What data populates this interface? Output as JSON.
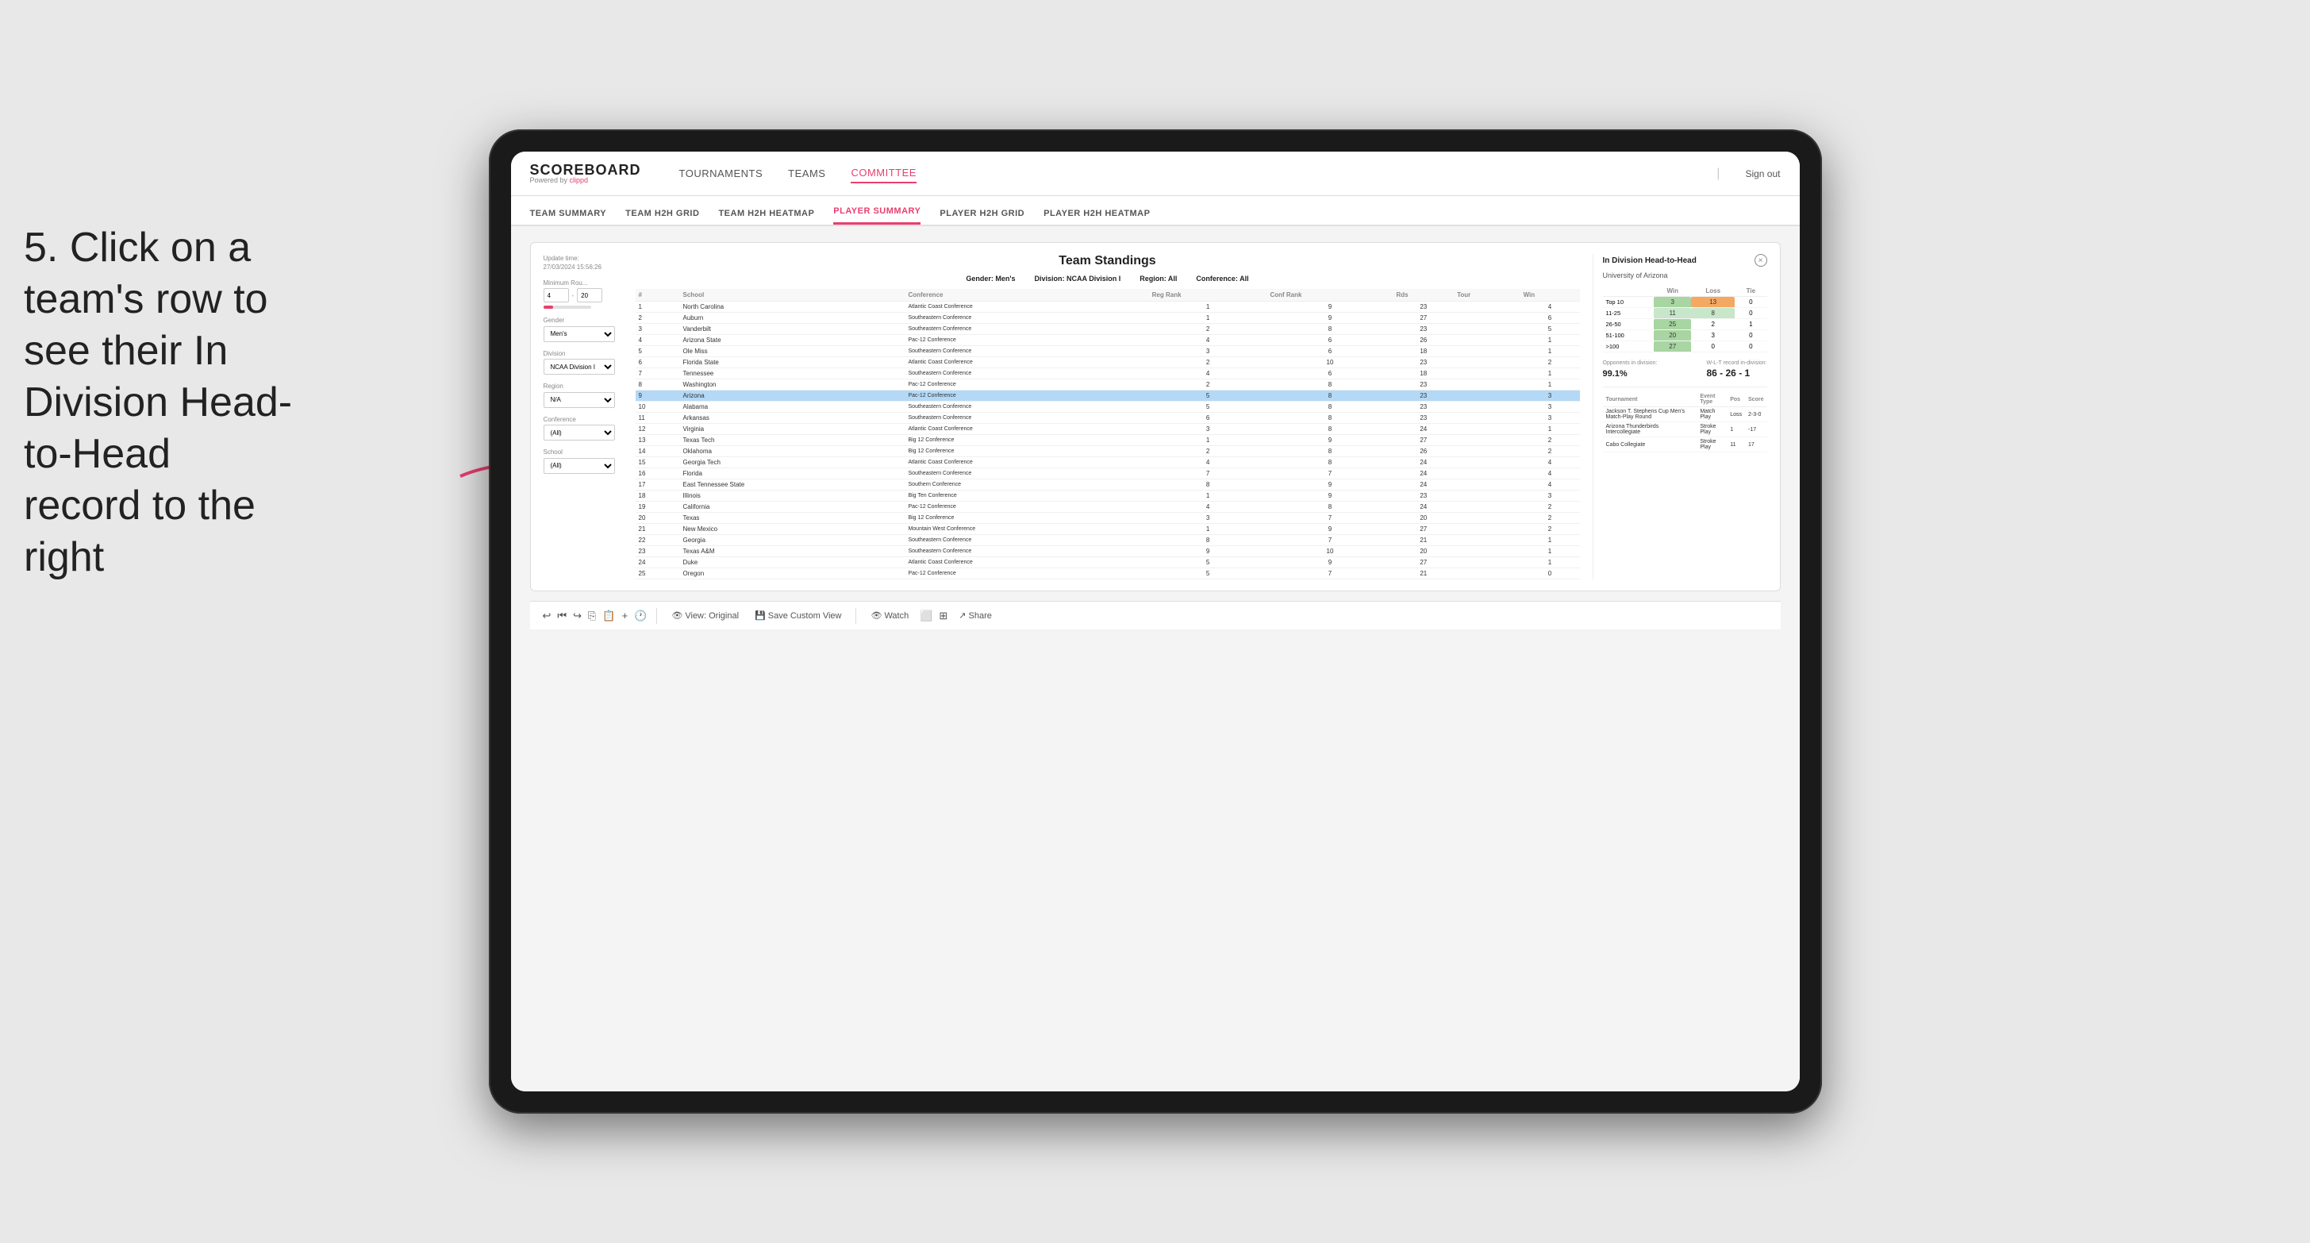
{
  "instruction": {
    "text": "5. Click on a team's row to see their In Division Head-to-Head record to the right"
  },
  "nav": {
    "logo_main": "SCOREBOARD",
    "logo_sub": "Powered by",
    "logo_brand": "clippd",
    "items": [
      "TOURNAMENTS",
      "TEAMS",
      "COMMITTEE"
    ],
    "active_item": "COMMITTEE",
    "sign_out": "Sign out"
  },
  "sub_nav": {
    "items": [
      "TEAM SUMMARY",
      "TEAM H2H GRID",
      "TEAM H2H HEATMAP",
      "PLAYER SUMMARY",
      "PLAYER H2H GRID",
      "PLAYER H2H HEATMAP"
    ],
    "active_item": "PLAYER SUMMARY"
  },
  "update_time_label": "Update time:",
  "update_time": "27/03/2024 15:56:26",
  "standings": {
    "title": "Team Standings",
    "meta": {
      "gender_label": "Gender:",
      "gender": "Men's",
      "division_label": "Division:",
      "division": "NCAA Division I",
      "region_label": "Region:",
      "region": "All",
      "conference_label": "Conference:",
      "conference": "All"
    },
    "filters": {
      "minimum_rou_label": "Minimum Rou...",
      "min_value": "4",
      "max_value": "20",
      "gender_label": "Gender",
      "gender_value": "Men's",
      "division_label": "Division",
      "division_value": "NCAA Division I",
      "region_label": "Region",
      "region_value": "N/A",
      "conference_label": "Conference",
      "conference_value": "(All)",
      "school_label": "School",
      "school_value": "(All)"
    },
    "columns": [
      "#",
      "School",
      "Conference",
      "Reg Rank",
      "Conf Rank",
      "Rds",
      "Tour",
      "Win"
    ],
    "rows": [
      {
        "rank": 1,
        "school": "North Carolina",
        "conference": "Atlantic Coast Conference",
        "reg_rank": 1,
        "conf_rank": 9,
        "rds": 23,
        "tour": "",
        "win": 4
      },
      {
        "rank": 2,
        "school": "Auburn",
        "conference": "Southeastern Conference",
        "reg_rank": 1,
        "conf_rank": 9,
        "rds": 27,
        "tour": "",
        "win": 6
      },
      {
        "rank": 3,
        "school": "Vanderbilt",
        "conference": "Southeastern Conference",
        "reg_rank": 2,
        "conf_rank": 8,
        "rds": 23,
        "tour": "",
        "win": 5
      },
      {
        "rank": 4,
        "school": "Arizona State",
        "conference": "Pac-12 Conference",
        "reg_rank": 4,
        "conf_rank": 6,
        "rds": 26,
        "tour": "",
        "win": 1
      },
      {
        "rank": 5,
        "school": "Ole Miss",
        "conference": "Southeastern Conference",
        "reg_rank": 3,
        "conf_rank": 6,
        "rds": 18,
        "tour": "",
        "win": 1
      },
      {
        "rank": 6,
        "school": "Florida State",
        "conference": "Atlantic Coast Conference",
        "reg_rank": 2,
        "conf_rank": 10,
        "rds": 23,
        "tour": "",
        "win": 2
      },
      {
        "rank": 7,
        "school": "Tennessee",
        "conference": "Southeastern Conference",
        "reg_rank": 4,
        "conf_rank": 6,
        "rds": 18,
        "tour": "",
        "win": 1
      },
      {
        "rank": 8,
        "school": "Washington",
        "conference": "Pac-12 Conference",
        "reg_rank": 2,
        "conf_rank": 8,
        "rds": 23,
        "tour": "",
        "win": 1
      },
      {
        "rank": 9,
        "school": "Arizona",
        "conference": "Pac-12 Conference",
        "reg_rank": 5,
        "conf_rank": 8,
        "rds": 23,
        "tour": "",
        "win": 3,
        "selected": true
      },
      {
        "rank": 10,
        "school": "Alabama",
        "conference": "Southeastern Conference",
        "reg_rank": 5,
        "conf_rank": 8,
        "rds": 23,
        "tour": "",
        "win": 3
      },
      {
        "rank": 11,
        "school": "Arkansas",
        "conference": "Southeastern Conference",
        "reg_rank": 6,
        "conf_rank": 8,
        "rds": 23,
        "tour": "",
        "win": 3
      },
      {
        "rank": 12,
        "school": "Virginia",
        "conference": "Atlantic Coast Conference",
        "reg_rank": 3,
        "conf_rank": 8,
        "rds": 24,
        "tour": "",
        "win": 1
      },
      {
        "rank": 13,
        "school": "Texas Tech",
        "conference": "Big 12 Conference",
        "reg_rank": 1,
        "conf_rank": 9,
        "rds": 27,
        "tour": "",
        "win": 2
      },
      {
        "rank": 14,
        "school": "Oklahoma",
        "conference": "Big 12 Conference",
        "reg_rank": 2,
        "conf_rank": 8,
        "rds": 26,
        "tour": "",
        "win": 2
      },
      {
        "rank": 15,
        "school": "Georgia Tech",
        "conference": "Atlantic Coast Conference",
        "reg_rank": 4,
        "conf_rank": 8,
        "rds": 24,
        "tour": "",
        "win": 4
      },
      {
        "rank": 16,
        "school": "Florida",
        "conference": "Southeastern Conference",
        "reg_rank": 7,
        "conf_rank": 7,
        "rds": 24,
        "tour": "",
        "win": 4
      },
      {
        "rank": 17,
        "school": "East Tennessee State",
        "conference": "Southern Conference",
        "reg_rank": 8,
        "conf_rank": 9,
        "rds": 24,
        "tour": "",
        "win": 4
      },
      {
        "rank": 18,
        "school": "Illinois",
        "conference": "Big Ten Conference",
        "reg_rank": 1,
        "conf_rank": 9,
        "rds": 23,
        "tour": "",
        "win": 3
      },
      {
        "rank": 19,
        "school": "California",
        "conference": "Pac-12 Conference",
        "reg_rank": 4,
        "conf_rank": 8,
        "rds": 24,
        "tour": "",
        "win": 2
      },
      {
        "rank": 20,
        "school": "Texas",
        "conference": "Big 12 Conference",
        "reg_rank": 3,
        "conf_rank": 7,
        "rds": 20,
        "tour": "",
        "win": 2
      },
      {
        "rank": 21,
        "school": "New Mexico",
        "conference": "Mountain West Conference",
        "reg_rank": 1,
        "conf_rank": 9,
        "rds": 27,
        "tour": "",
        "win": 2
      },
      {
        "rank": 22,
        "school": "Georgia",
        "conference": "Southeastern Conference",
        "reg_rank": 8,
        "conf_rank": 7,
        "rds": 21,
        "tour": "",
        "win": 1
      },
      {
        "rank": 23,
        "school": "Texas A&M",
        "conference": "Southeastern Conference",
        "reg_rank": 9,
        "conf_rank": 10,
        "rds": 20,
        "tour": "",
        "win": 1
      },
      {
        "rank": 24,
        "school": "Duke",
        "conference": "Atlantic Coast Conference",
        "reg_rank": 5,
        "conf_rank": 9,
        "rds": 27,
        "tour": "",
        "win": 1
      },
      {
        "rank": 25,
        "school": "Oregon",
        "conference": "Pac-12 Conference",
        "reg_rank": 5,
        "conf_rank": 7,
        "rds": 21,
        "tour": "",
        "win": 0
      }
    ]
  },
  "h2h": {
    "title": "In Division Head-to-Head",
    "team": "University of Arizona",
    "close_btn": "×",
    "columns": [
      "",
      "Win",
      "Loss",
      "Tie"
    ],
    "rows": [
      {
        "label": "Top 10",
        "win": 3,
        "loss": 13,
        "tie": 0,
        "win_color": "green",
        "loss_color": "orange"
      },
      {
        "label": "11-25",
        "win": 11,
        "loss": 8,
        "tie": 0,
        "win_color": "lt-green",
        "loss_color": "lt-green"
      },
      {
        "label": "26-50",
        "win": 25,
        "loss": 2,
        "tie": 1,
        "win_color": "green",
        "loss_color": ""
      },
      {
        "label": "51-100",
        "win": 20,
        "loss": 3,
        "tie": 0,
        "win_color": "green",
        "loss_color": ""
      },
      {
        "label": ">100",
        "win": 27,
        "loss": 0,
        "tie": 0,
        "win_color": "green",
        "loss_color": ""
      }
    ],
    "opponents_label": "Opponents in division:",
    "opponents_pct": "99.1%",
    "record_label": "W-L-T record in-division:",
    "record": "86 - 26 - 1",
    "tournament_columns": [
      "Tournament",
      "Event Type",
      "Pos",
      "Score"
    ],
    "tournaments": [
      {
        "name": "Jackson T. Stephens Cup Men's Match-Play Round",
        "type": "Match Play",
        "pos": "Loss",
        "score": "2-3-0"
      },
      {
        "name": "Arizona Thunderbirds Intercollegiate",
        "type": "Stroke Play",
        "pos": "1",
        "score": "-17"
      },
      {
        "name": "Cabo Collegiate",
        "type": "Stroke Play",
        "pos": "11",
        "score": "17"
      }
    ]
  },
  "toolbar": {
    "undo": "↩",
    "redo": "↪",
    "copy": "⎘",
    "view_original": "View: Original",
    "save_custom": "Save Custom View",
    "watch": "Watch",
    "share": "Share"
  }
}
